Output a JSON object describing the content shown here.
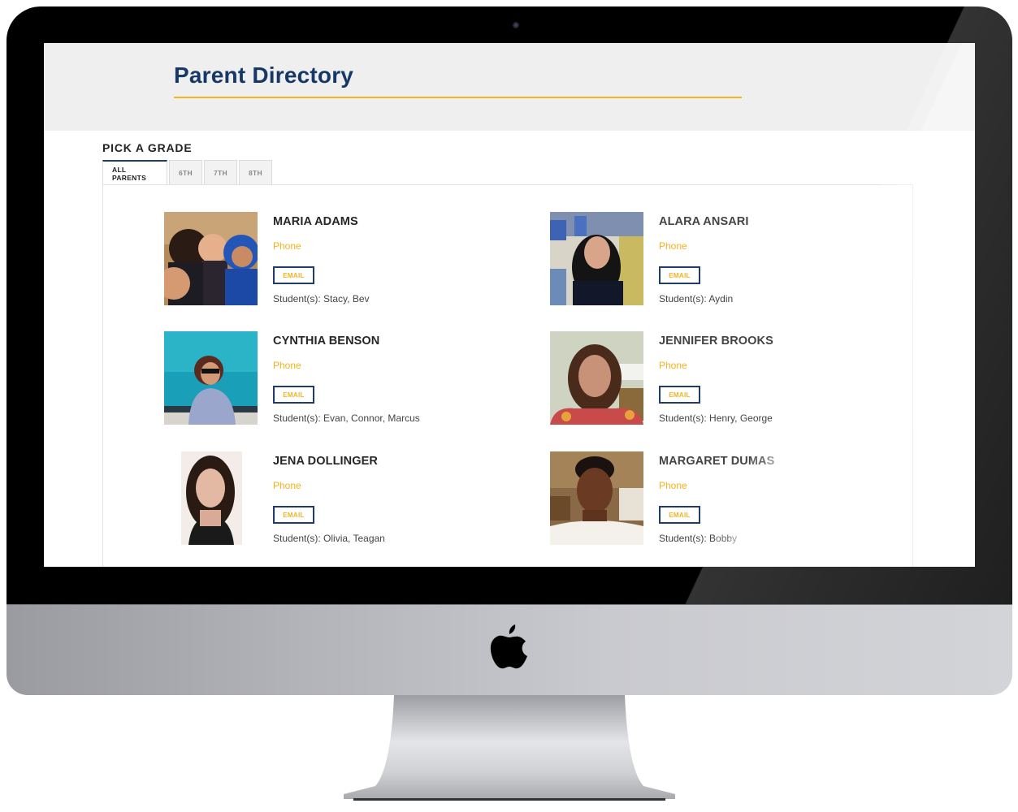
{
  "page": {
    "title": "Parent Directory",
    "section_label": "PICK A GRADE"
  },
  "colors": {
    "title_navy": "#173866",
    "accent_gold": "#f5b21d",
    "button_border_navy": "#1f3c6c",
    "header_bg": "#efefef"
  },
  "tabs": [
    {
      "label": "ALL PARENTS",
      "active": true
    },
    {
      "label": "6TH",
      "active": false
    },
    {
      "label": "7TH",
      "active": false
    },
    {
      "label": "8TH",
      "active": false
    }
  ],
  "parents": [
    {
      "name": "MARIA ADAMS",
      "phone_label": "Phone",
      "email_label": "EMAIL",
      "students": "Student(s): Stacy, Bev",
      "photo": "family-selfie"
    },
    {
      "name": "ALARA ANSARI",
      "phone_label": "Phone",
      "email_label": "EMAIL",
      "students": "Student(s): Aydin",
      "photo": "woman-stadium"
    },
    {
      "name": "CYNTHIA BENSON",
      "phone_label": "Phone",
      "email_label": "EMAIL",
      "students": "Student(s): Evan, Connor, Marcus",
      "photo": "woman-ocean"
    },
    {
      "name": "JENNIFER BROOKS",
      "phone_label": "Phone",
      "email_label": "EMAIL",
      "students": "Student(s): Henry, George",
      "photo": "woman-indoors"
    },
    {
      "name": "JENA DOLLINGER",
      "phone_label": "Phone",
      "email_label": "EMAIL",
      "students": "Student(s): Olivia, Teagan",
      "photo": "woman-portrait"
    },
    {
      "name": "MARGARET DUMAS",
      "phone_label": "Phone",
      "email_label": "EMAIL",
      "students": "Student(s): Bobby",
      "photo": "woman-home"
    }
  ],
  "device": {
    "frame": "desktop-monitor",
    "logo_icon": "apple-logo-icon"
  }
}
